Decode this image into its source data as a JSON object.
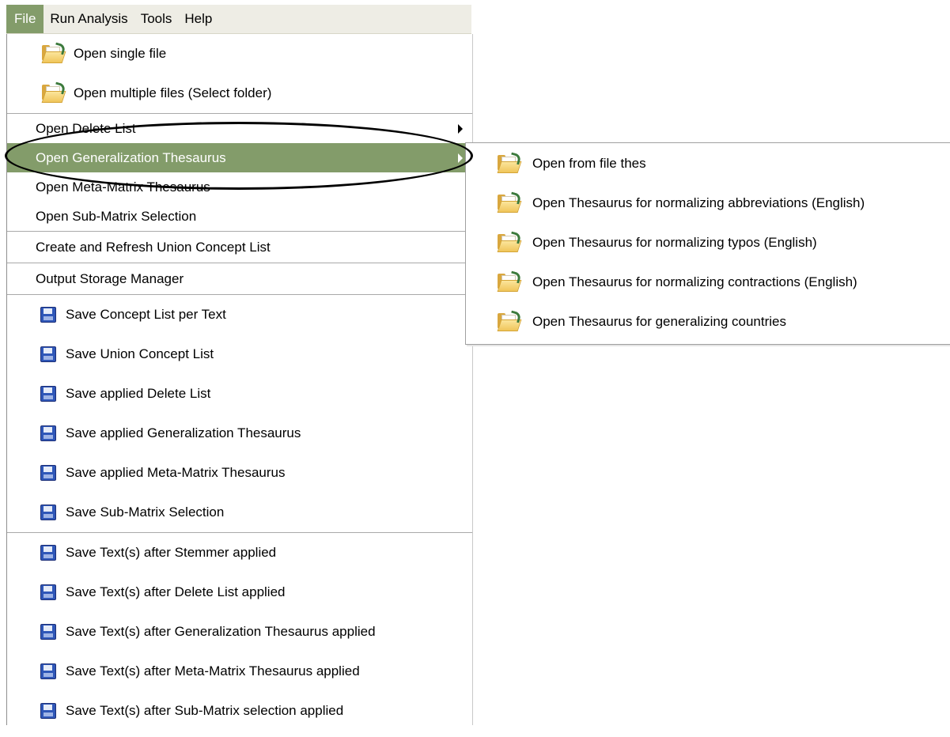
{
  "menubar": {
    "items": [
      {
        "label": "File",
        "active": true
      },
      {
        "label": "Run Analysis"
      },
      {
        "label": "Tools"
      },
      {
        "label": "Help"
      }
    ]
  },
  "file_menu": {
    "open_single": "Open single file",
    "open_multiple": "Open multiple files (Select folder)",
    "open_delete_list": "Open Delete List",
    "open_generalization": "Open Generalization Thesaurus",
    "open_meta_matrix": "Open Meta-Matrix Thesaurus",
    "open_sub_matrix": "Open Sub-Matrix Selection",
    "create_refresh": "Create and Refresh Union Concept List",
    "output_storage": "Output Storage Manager",
    "save_concept_list": "Save Concept List per Text",
    "save_union": "Save Union Concept List",
    "save_delete_list": "Save applied Delete List",
    "save_generalization": "Save applied Generalization Thesaurus",
    "save_meta_matrix": "Save applied Meta-Matrix Thesaurus",
    "save_sub_matrix": "Save Sub-Matrix Selection",
    "save_text_stemmer": "Save Text(s) after Stemmer applied",
    "save_text_delete": "Save Text(s) after Delete List applied",
    "save_text_generalization": "Save Text(s) after Generalization Thesaurus applied",
    "save_text_meta": "Save Text(s) after Meta-Matrix Thesaurus applied",
    "save_text_sub": "Save Text(s) after Sub-Matrix selection applied"
  },
  "submenu": {
    "items": [
      "Open from file thes",
      "Open Thesaurus for normalizing abbreviations (English)",
      "Open Thesaurus for normalizing typos (English)",
      "Open Thesaurus for normalizing contractions (English)",
      "Open Thesaurus for generalizing countries"
    ]
  },
  "colors": {
    "highlight": "#839c6a",
    "menubar_bg": "#eeede5",
    "folder": "#f0c55a",
    "disk": "#2f57b8"
  },
  "icons": {
    "open": "folder-open-icon",
    "save": "floppy-disk-icon"
  }
}
